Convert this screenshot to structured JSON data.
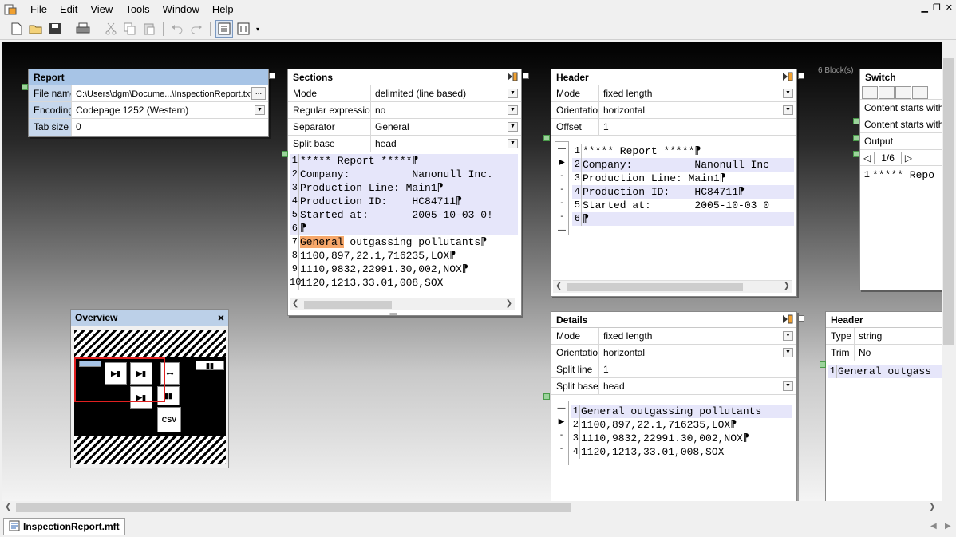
{
  "menu": [
    "File",
    "Edit",
    "View",
    "Tools",
    "Window",
    "Help"
  ],
  "status": {
    "doc_tab": "InspectionReport.mft"
  },
  "canvas": {
    "block_count": "6 Block(s)"
  },
  "report": {
    "title": "Report",
    "rows": [
      {
        "k": "File name",
        "v": "C:\\Users\\dgm\\Docume...\\InspectionReport.txt",
        "btn": "..."
      },
      {
        "k": "Encoding",
        "v": "Codepage 1252 (Western)"
      },
      {
        "k": "Tab size",
        "v": "0"
      }
    ]
  },
  "sections": {
    "title": "Sections",
    "rows": [
      {
        "k": "Mode",
        "v": "delimited (line based)"
      },
      {
        "k": "Regular expression",
        "v": "no"
      },
      {
        "k": "Separator",
        "v": "General"
      },
      {
        "k": "Split base",
        "v": "head"
      }
    ],
    "lines": [
      {
        "n": "1",
        "t": "***** Report *****⁋"
      },
      {
        "n": "2",
        "t": "Company:          Nanonull Inc."
      },
      {
        "n": "3",
        "t": "Production Line: Main1⁋"
      },
      {
        "n": "4",
        "t": "Production ID:    HC84711⁋"
      },
      {
        "n": "5",
        "t": "Started at:       2005-10-03 0!"
      },
      {
        "n": "6",
        "t": "⁋"
      },
      {
        "n": "7",
        "tok": "General",
        "t": " outgassing pollutants⁋"
      },
      {
        "n": "8",
        "t": "1100,897,22.1,716235,LOX⁋"
      },
      {
        "n": "9",
        "t": "1110,9832,22991.30,002,NOX⁋"
      },
      {
        "n": "10",
        "t": "1120,1213,33.01,008,SOX"
      }
    ]
  },
  "header1": {
    "title": "Header",
    "rows": [
      {
        "k": "Mode",
        "v": "fixed length"
      },
      {
        "k": "Orientation",
        "v": "horizontal"
      },
      {
        "k": "Offset",
        "v": "1"
      }
    ],
    "lines": [
      {
        "n": "1",
        "t": "***** Report *****⁋"
      },
      {
        "n": "2",
        "t": "Company:          Nanonull Inc"
      },
      {
        "n": "3",
        "t": "Production Line: Main1⁋"
      },
      {
        "n": "4",
        "t": "Production ID:    HC84711⁋"
      },
      {
        "n": "5",
        "t": "Started at:       2005-10-03 0"
      },
      {
        "n": "6",
        "t": "⁋"
      }
    ]
  },
  "switch": {
    "title": "Switch",
    "rows": [
      "Content starts with ...",
      "Content starts with ..."
    ],
    "output_label": "Output",
    "pager": "1/6",
    "line": {
      "n": "1",
      "t": "***** Repo"
    }
  },
  "details": {
    "title": "Details",
    "rows": [
      {
        "k": "Mode",
        "v": "fixed length"
      },
      {
        "k": "Orientation",
        "v": "horizontal"
      },
      {
        "k": "Split line",
        "v": "1"
      },
      {
        "k": "Split base",
        "v": "head"
      }
    ],
    "lines": [
      {
        "n": "1",
        "t": "General outgassing pollutants"
      },
      {
        "n": "2",
        "t": "1100,897,22.1,716235,LOX⁋"
      },
      {
        "n": "3",
        "t": "1110,9832,22991.30,002,NOX⁋"
      },
      {
        "n": "4",
        "t": "1120,1213,33.01,008,SOX"
      }
    ]
  },
  "header2": {
    "title": "Header",
    "rows": [
      {
        "k": "Type",
        "v": "string"
      },
      {
        "k": "Trim",
        "v": "No"
      }
    ],
    "line": {
      "n": "1",
      "t": "General outgass"
    }
  },
  "overview": {
    "title": "Overview",
    "close": "×",
    "csv_label": "CSV"
  }
}
